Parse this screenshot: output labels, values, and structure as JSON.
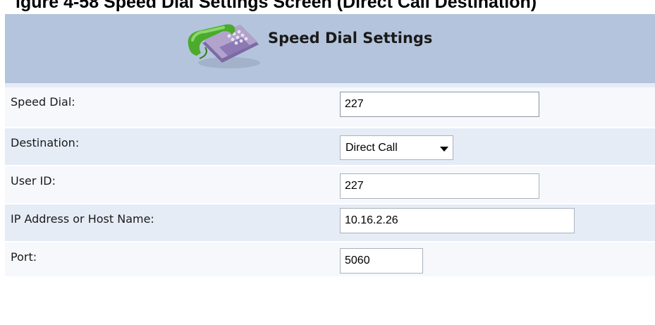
{
  "caption": "igure 4-58 Speed Dial Settings Screen (Direct Call Destination)",
  "header": {
    "title": "Speed Dial Settings",
    "icon": "telephone-icon"
  },
  "form": {
    "speed_dial": {
      "label": "Speed Dial:",
      "value": "227"
    },
    "destination": {
      "label": "Destination:",
      "value": "Direct Call"
    },
    "user_id": {
      "label": "User ID:",
      "value": "227"
    },
    "ip_address": {
      "label": "IP Address or Host Name:",
      "value": "10.16.2.26"
    },
    "port": {
      "label": "Port:",
      "value": "5060"
    }
  },
  "colors": {
    "header_bg": "#b4c4dc",
    "row_shade": "#e6ecf6",
    "row_plain": "#f6f8fc",
    "phone_handset": "#4caa2c",
    "phone_body": "#b1a3cc"
  }
}
